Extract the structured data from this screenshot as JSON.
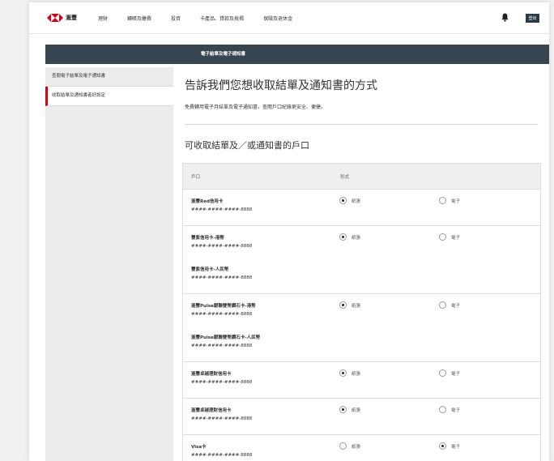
{
  "brand": {
    "name": "滙豐",
    "color_red": "#db0011"
  },
  "nav": {
    "links": [
      "理財",
      "轉賬及繳費",
      "投資",
      "卡產品、貸款及按揭",
      "保險及退休金"
    ],
    "logout": "登出"
  },
  "header": {
    "title": "電子結單及電子通知書"
  },
  "sidebar": {
    "items": [
      {
        "label": "查閱電子結單及電子通知書",
        "active": false
      },
      {
        "label": "收取結單及通知書者好設定",
        "active": true
      }
    ]
  },
  "main": {
    "title": "告訴我們您想收取結單及通知書的方式",
    "description": "免費轉用電子月結單及電子通知書，查閱戶口紀錄更安全、便捷。",
    "section_title": "可收取結單及／或通知書的戶口",
    "table": {
      "col_account": "戶口",
      "col_format": "形式",
      "option_paper": "紙張",
      "option_electronic": "電子",
      "rows": [
        {
          "accounts": [
            {
              "name": "滙豐Red信用卡",
              "number": "####-####-####-8888"
            }
          ],
          "selected": "paper"
        },
        {
          "accounts": [
            {
              "name": "豐紫信用卡-港幣",
              "number": "####-####-####-8888"
            },
            {
              "name": "豐紫信用卡-人民幣",
              "number": "####-####-####-8888"
            }
          ],
          "selected": "paper"
        },
        {
          "accounts": [
            {
              "name": "滙豐Pulse銀聯雙幣鑽石卡-港幣",
              "number": "####-####-####-8888"
            },
            {
              "name": "滙豐Pulse銀聯雙幣鑽石卡-人民幣",
              "number": "####-####-####-8888"
            }
          ],
          "selected": "paper"
        },
        {
          "accounts": [
            {
              "name": "滙豐卓越理財信用卡",
              "number": "####-####-####-8888"
            }
          ],
          "selected": "paper"
        },
        {
          "accounts": [
            {
              "name": "滙豐卓越理財信用卡",
              "number": "####-####-####-8888"
            }
          ],
          "selected": "paper"
        },
        {
          "accounts": [
            {
              "name": "Visa卡",
              "number": "####-####-####-8888"
            }
          ],
          "selected": "electronic"
        }
      ]
    }
  }
}
